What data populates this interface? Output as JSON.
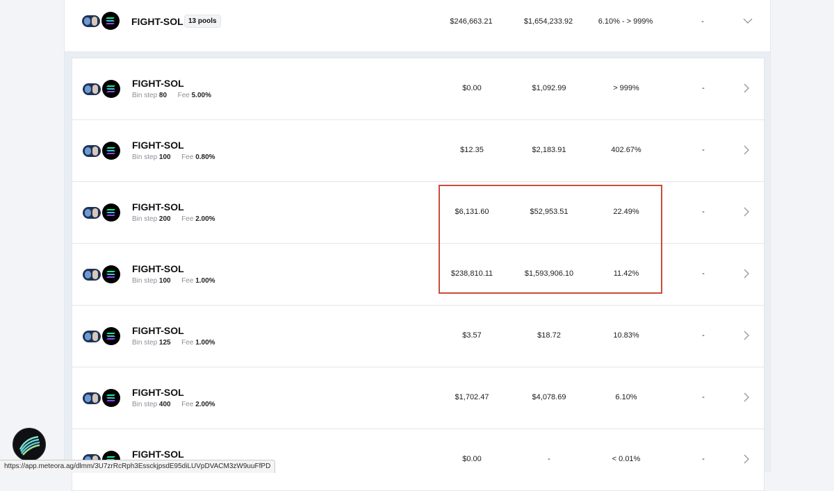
{
  "group": {
    "pair": "FIGHT-SOL",
    "pools_badge": "13 pools",
    "liquidity": "$246,663.21",
    "volume": "$1,654,233.92",
    "apr": "6.10% - > 999%",
    "extra": "-"
  },
  "pools": [
    {
      "pair": "FIGHT-SOL",
      "bin_step_label": "Bin step",
      "bin_step": "80",
      "fee_label": "Fee",
      "fee": "5.00%",
      "liquidity": "$0.00",
      "volume": "$1,092.99",
      "apr": "> 999%",
      "extra": "-"
    },
    {
      "pair": "FIGHT-SOL",
      "bin_step_label": "Bin step",
      "bin_step": "100",
      "fee_label": "Fee",
      "fee": "0.80%",
      "liquidity": "$12.35",
      "volume": "$2,183.91",
      "apr": "402.67%",
      "extra": "-"
    },
    {
      "pair": "FIGHT-SOL",
      "bin_step_label": "Bin step",
      "bin_step": "200",
      "fee_label": "Fee",
      "fee": "2.00%",
      "liquidity": "$6,131.60",
      "volume": "$52,953.51",
      "apr": "22.49%",
      "extra": "-"
    },
    {
      "pair": "FIGHT-SOL",
      "bin_step_label": "Bin step",
      "bin_step": "100",
      "fee_label": "Fee",
      "fee": "1.00%",
      "liquidity": "$238,810.11",
      "volume": "$1,593,906.10",
      "apr": "11.42%",
      "extra": "-"
    },
    {
      "pair": "FIGHT-SOL",
      "bin_step_label": "Bin step",
      "bin_step": "125",
      "fee_label": "Fee",
      "fee": "1.00%",
      "liquidity": "$3.57",
      "volume": "$18.72",
      "apr": "10.83%",
      "extra": "-"
    },
    {
      "pair": "FIGHT-SOL",
      "bin_step_label": "Bin step",
      "bin_step": "400",
      "fee_label": "Fee",
      "fee": "2.00%",
      "liquidity": "$1,702.47",
      "volume": "$4,078.69",
      "apr": "6.10%",
      "extra": "-"
    },
    {
      "pair": "FIGHT-SOL",
      "bin_step_label": "",
      "bin_step": "",
      "fee_label": "",
      "fee": "",
      "liquidity": "$0.00",
      "volume": "-",
      "apr": "< 0.01%",
      "extra": "-"
    }
  ],
  "status_url": "https://app.meteora.ag/dlmm/3U7zrRcRph3EssckjpsdE95diLUVpDVACM3zW9uuFfPD",
  "colors": {
    "highlight": "#c94b3a",
    "panel_bg": "#ffffff",
    "group_bg": "#e9eef4"
  },
  "icons": {
    "token_a": "fight-token-icon",
    "token_b": "sol-token-icon",
    "expand": "chevron-down-icon",
    "open": "chevron-right-icon",
    "app_logo": "meteora-logo"
  }
}
